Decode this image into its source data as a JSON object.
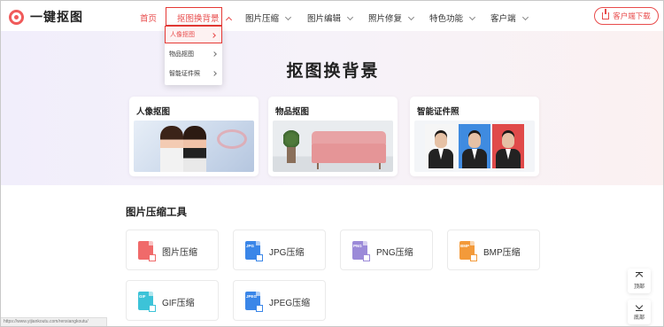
{
  "header": {
    "brand": "一键抠图",
    "nav": [
      {
        "label": "首页"
      },
      {
        "label": "抠图换背景"
      },
      {
        "label": "图片压缩"
      },
      {
        "label": "图片编辑"
      },
      {
        "label": "照片修复"
      },
      {
        "label": "特色功能"
      },
      {
        "label": "客户端"
      }
    ],
    "download_label": "客户端下载"
  },
  "dropdown": {
    "items": [
      {
        "label": "人像抠图"
      },
      {
        "label": "物品抠图"
      },
      {
        "label": "智能证件照"
      }
    ]
  },
  "hero": {
    "title": "抠图换背景",
    "cards": [
      {
        "title": "人像抠图"
      },
      {
        "title": "物品抠图"
      },
      {
        "title": "智能证件照"
      }
    ]
  },
  "tools": {
    "section_title": "图片压缩工具",
    "items": [
      {
        "label": "图片压缩",
        "icon": "image-file-icon",
        "tag": "",
        "color": "#f06a6a"
      },
      {
        "label": "JPG压缩",
        "icon": "jpg-file-icon",
        "tag": "JPG",
        "color": "#3a86e8"
      },
      {
        "label": "PNG压缩",
        "icon": "png-file-icon",
        "tag": "PNG",
        "color": "#9b8ad8"
      },
      {
        "label": "BMP压缩",
        "icon": "bmp-file-icon",
        "tag": "BMP",
        "color": "#f39a3a"
      },
      {
        "label": "GIF压缩",
        "icon": "gif-file-icon",
        "tag": "GIF",
        "color": "#3cc3d8"
      },
      {
        "label": "JPEG压缩",
        "icon": "jpeg-file-icon",
        "tag": "JPEG",
        "color": "#3a86e8"
      }
    ]
  },
  "side": {
    "top_label": "顶部",
    "bottom_label": "底部"
  },
  "status_url": "https://www.yijiankoutu.com/renxiangkoutu/",
  "colors": {
    "accent": "#e84b4b"
  }
}
